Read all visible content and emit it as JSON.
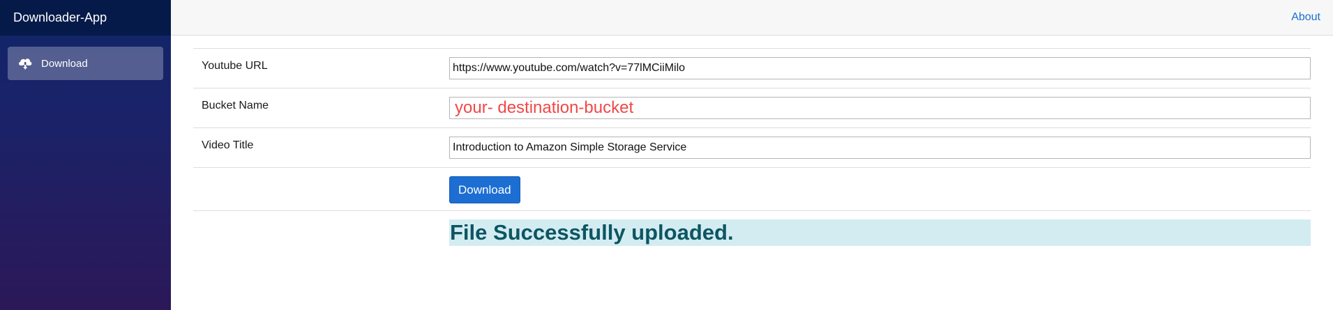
{
  "app": {
    "title": "Downloader-App"
  },
  "sidebar": {
    "items": [
      {
        "label": "Download",
        "icon": "cloud-download-icon"
      }
    ]
  },
  "topbar": {
    "about_label": "About"
  },
  "form": {
    "youtube_url": {
      "label": "Youtube URL",
      "value": "https://www.youtube.com/watch?v=77lMCiiMilo"
    },
    "bucket_name": {
      "label": "Bucket Name",
      "placeholder": "your- destination-bucket"
    },
    "video_title": {
      "label": "Video Title",
      "value": "Introduction to Amazon Simple Storage Service"
    },
    "submit_label": "Download"
  },
  "status": {
    "message": "File Successfully uploaded."
  },
  "colors": {
    "accent": "#1c6ed3",
    "link": "#1a6fd1",
    "placeholder": "#f04848",
    "success_bg": "#d3ecf1",
    "success_text": "#0d5562"
  }
}
